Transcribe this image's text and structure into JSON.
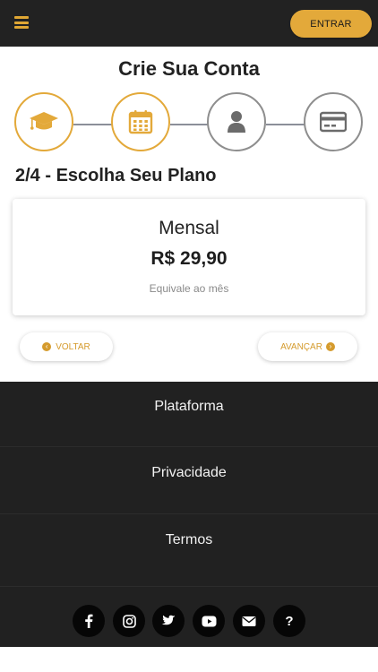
{
  "header": {
    "menu_icon": "hamburger-icon",
    "login_label": "ENTRAR",
    "accent_color": "#e3a93a"
  },
  "page": {
    "title": "Crie Sua Conta",
    "step_heading": "2/4 - Escolha Seu Plano"
  },
  "stepper": {
    "steps": [
      {
        "icon": "graduation-cap-icon",
        "state": "completed"
      },
      {
        "icon": "calendar-icon",
        "state": "current"
      },
      {
        "icon": "user-icon",
        "state": "pending"
      },
      {
        "icon": "credit-card-icon",
        "state": "pending"
      }
    ]
  },
  "plan": {
    "name": "Mensal",
    "price": "R$ 29,90",
    "note": "Equivale ao mês"
  },
  "navigation": {
    "back_label": "VOLTAR",
    "next_label": "AVANÇAR"
  },
  "footer": {
    "links": [
      "Plataforma",
      "Privacidade",
      "Termos"
    ],
    "social": [
      {
        "icon": "facebook-icon"
      },
      {
        "icon": "instagram-icon"
      },
      {
        "icon": "twitter-icon"
      },
      {
        "icon": "youtube-icon"
      },
      {
        "icon": "email-icon"
      },
      {
        "icon": "help-icon",
        "glyph": "?"
      }
    ]
  }
}
